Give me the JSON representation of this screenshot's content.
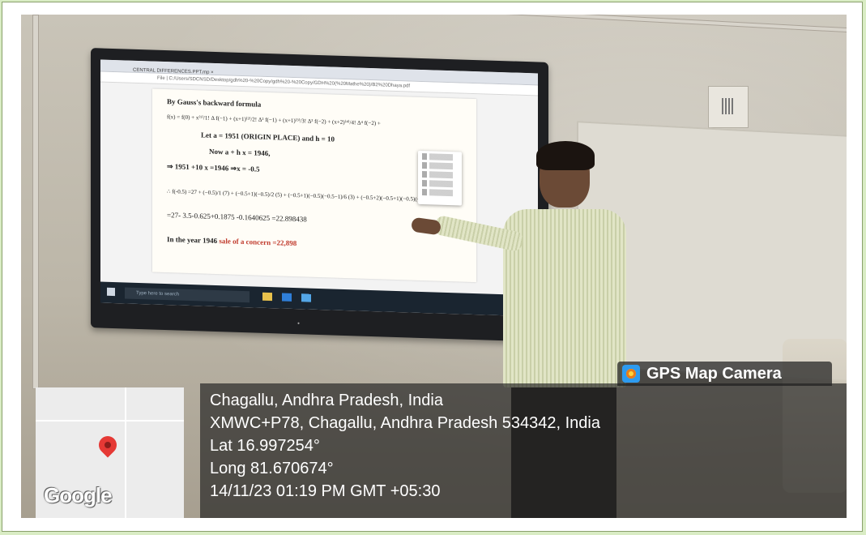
{
  "board": {
    "tab_title": "CENTRAL DIFFERENCES.PPT.mp ×",
    "address": "File | C:/Users/SDCNSD/Desktop/gdh%20-%20Copy/gdh%20-%20Copy/GDH%20(%20Mathe%20)/B2%20Dhaya.pdf",
    "doc_lines": [
      "By Gauss's backward formula",
      "f(x) = f(0) + x⁽¹⁾/1! Δ f(−1) + (x+1)⁽²⁾/2! Δ² f(−1) + (x+1)⁽³⁾/3! Δ³ f(−2) + (x+2)⁽⁴⁾/4! Δ⁴ f(−2) +",
      "Let a = 1951 (ORIGIN PLACE) and h = 10",
      "Now  a + h x = 1946,",
      "⇒ 1951 +10 x =1946 ⇒x = -0.5",
      "∴ f(-0.5) =27 + (−0.5)/1 (7) + (−0.5+1)(−0.5)/2 (5) + (−0.5+1)(−0.5)(−0.5−1)/6 (3) + (−0.5+2)(−0.5+1)(−0.5)(−0.5−1)/24 (−7)",
      "=27- 3.5-0.625+0.1875 -0.1640625 =22.898438",
      "In the year 1946 "
    ],
    "doc_highlight": "sale of a concern =22,898",
    "taskbar_search": "Type here to search"
  },
  "overlay": {
    "app_label": "GPS Map Camera",
    "place": "Chagallu, Andhra Pradesh, India",
    "address": "XMWC+P78, Chagallu, Andhra Pradesh 534342, India",
    "lat": "Lat 16.997254°",
    "long": "Long 81.670674°",
    "datetime": "14/11/23 01:19 PM GMT +05:30",
    "map_brand": "Google"
  }
}
